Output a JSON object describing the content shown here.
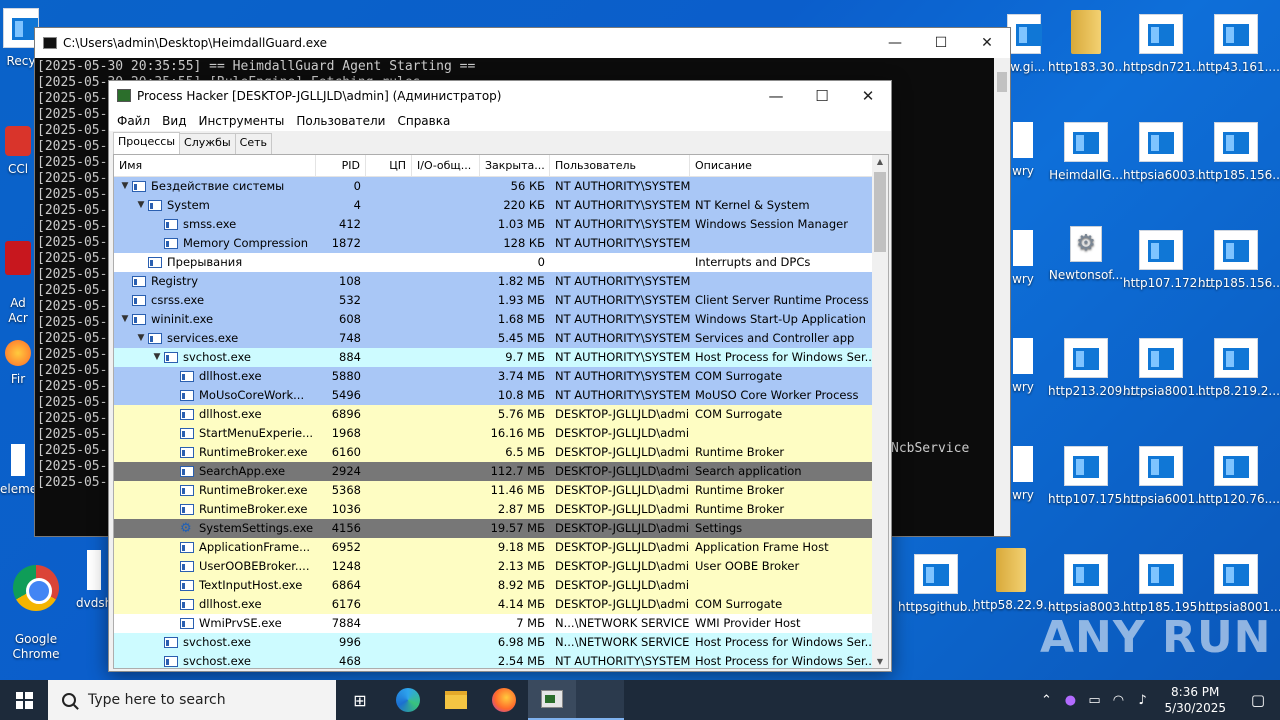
{
  "desktop": {
    "icons_left": [
      {
        "label": "Recy"
      },
      {
        "label": "CCl"
      },
      {
        "label": "Ad\nAcr"
      },
      {
        "label": "Fir"
      },
      {
        "label": "eleme"
      },
      {
        "label": "Google\nChrome"
      },
      {
        "label": "dvdsh"
      }
    ],
    "icons_right": [
      {
        "label": "aw.gi..."
      },
      {
        "label": "http183.30...."
      },
      {
        "label": "httpsdn721..."
      },
      {
        "label": "http43.161...."
      },
      {
        "label": "wry"
      },
      {
        "label": "HeimdallG..."
      },
      {
        "label": "httpsia6003..."
      },
      {
        "label": "http185.156...."
      },
      {
        "label": "wry"
      },
      {
        "label": "Newtonsof..."
      },
      {
        "label": "http107.172...."
      },
      {
        "label": "http185.156...."
      },
      {
        "label": "wry"
      },
      {
        "label": "http213.209...."
      },
      {
        "label": "httpsia8001..."
      },
      {
        "label": "http8.219.2...."
      },
      {
        "label": "wry"
      },
      {
        "label": "http107.175...."
      },
      {
        "label": "httpsia6001..."
      },
      {
        "label": "http120.76...."
      },
      {
        "label": "httpsgithub..."
      },
      {
        "label": "http58.22.9...."
      },
      {
        "label": "httpsia8003..."
      },
      {
        "label": "http185.195...."
      },
      {
        "label": "httpsia8001..."
      }
    ]
  },
  "console": {
    "title": "C:\\Users\\admin\\Desktop\\HeimdallGuard.exe",
    "lines": "[2025-05-30 20:35:55] == HeimdallGuard Agent Starting ==\n[2025-05-30 20:35:55] [RuleEngine] Fetching rules...\n[2025-05-\n[2025-05-\n[2025-05-\n[2025-05-\n[2025-05-\n[2025-05-\n[2025-05-\n[2025-05-\n[2025-05-\n[2025-05-\n[2025-05-\n[2025-05-\n[2025-05-\n[2025-05-\n[2025-05-\n[2025-05-\n[2025-05-\n[2025-05-\n[2025-05-\n[2025-05-\n[2025-05-\n[2025-05-\n[2025-05-\n[2025-05-\n[2025-05-",
    "side_text": "NcbService"
  },
  "ph": {
    "title": "Process Hacker [DESKTOP-JGLLJLD\\admin] (Администратор)",
    "menu": [
      "Файл",
      "Вид",
      "Инструменты",
      "Пользователи",
      "Справка"
    ],
    "tabs": [
      "Процессы",
      "Службы",
      "Сеть"
    ],
    "columns": {
      "name": "Имя",
      "pid": "PID",
      "cpu": "ЦП",
      "io": "I/O-общ...",
      "mem": "Закрыта...",
      "user": "Пользователь",
      "desc": "Описание"
    },
    "rows": [
      {
        "name": "Бездействие системы",
        "pid": "0",
        "mem": "56 КБ",
        "user": "NT AUTHORITY\\SYSTEM",
        "desc": "",
        "level": 0,
        "arrow": "v",
        "bg": "blue",
        "icon": "window"
      },
      {
        "name": "System",
        "pid": "4",
        "mem": "220 КБ",
        "user": "NT AUTHORITY\\SYSTEM",
        "desc": "NT Kernel & System",
        "level": 1,
        "arrow": "v",
        "bg": "blue",
        "icon": "window"
      },
      {
        "name": "smss.exe",
        "pid": "412",
        "mem": "1.03 МБ",
        "user": "NT AUTHORITY\\SYSTEM",
        "desc": "Windows Session Manager",
        "level": 2,
        "arrow": "",
        "bg": "blue",
        "icon": "window"
      },
      {
        "name": "Memory Compression",
        "pid": "1872",
        "mem": "128 КБ",
        "user": "NT AUTHORITY\\SYSTEM",
        "desc": "",
        "level": 2,
        "arrow": "",
        "bg": "blue",
        "icon": "window"
      },
      {
        "name": "Прерывания",
        "pid": "",
        "mem": "0",
        "user": "",
        "desc": "Interrupts and DPCs",
        "level": 1,
        "arrow": "",
        "bg": "white",
        "icon": "window"
      },
      {
        "name": "Registry",
        "pid": "108",
        "mem": "1.82 МБ",
        "user": "NT AUTHORITY\\SYSTEM",
        "desc": "",
        "level": 0,
        "arrow": "",
        "bg": "blue",
        "icon": "window"
      },
      {
        "name": "csrss.exe",
        "pid": "532",
        "mem": "1.93 МБ",
        "user": "NT AUTHORITY\\SYSTEM",
        "desc": "Client Server Runtime Process",
        "level": 0,
        "arrow": "",
        "bg": "blue",
        "icon": "window"
      },
      {
        "name": "wininit.exe",
        "pid": "608",
        "mem": "1.68 МБ",
        "user": "NT AUTHORITY\\SYSTEM",
        "desc": "Windows Start-Up Application",
        "level": 0,
        "arrow": "v",
        "bg": "blue",
        "icon": "window"
      },
      {
        "name": "services.exe",
        "pid": "748",
        "mem": "5.45 МБ",
        "user": "NT AUTHORITY\\SYSTEM",
        "desc": "Services and Controller app",
        "level": 1,
        "arrow": "v",
        "bg": "blue",
        "icon": "window"
      },
      {
        "name": "svchost.exe",
        "pid": "884",
        "mem": "9.7 МБ",
        "user": "NT AUTHORITY\\SYSTEM",
        "desc": "Host Process for Windows Ser...",
        "level": 2,
        "arrow": "v",
        "bg": "cyan",
        "icon": "window"
      },
      {
        "name": "dllhost.exe",
        "pid": "5880",
        "mem": "3.74 МБ",
        "user": "NT AUTHORITY\\SYSTEM",
        "desc": "COM Surrogate",
        "level": 3,
        "arrow": "",
        "bg": "blue",
        "icon": "window"
      },
      {
        "name": "MoUsoCoreWork...",
        "pid": "5496",
        "mem": "10.8 МБ",
        "user": "NT AUTHORITY\\SYSTEM",
        "desc": "MoUSO Core Worker Process",
        "level": 3,
        "arrow": "",
        "bg": "blue",
        "icon": "window"
      },
      {
        "name": "dllhost.exe",
        "pid": "6896",
        "mem": "5.76 МБ",
        "user": "DESKTOP-JGLLJLD\\admi",
        "desc": "COM Surrogate",
        "level": 3,
        "arrow": "",
        "bg": "yellow",
        "icon": "window"
      },
      {
        "name": "StartMenuExperie...",
        "pid": "1968",
        "mem": "16.16 МБ",
        "user": "DESKTOP-JGLLJLD\\admi",
        "desc": "",
        "level": 3,
        "arrow": "",
        "bg": "yellow",
        "icon": "window"
      },
      {
        "name": "RuntimeBroker.exe",
        "pid": "6160",
        "mem": "6.5 МБ",
        "user": "DESKTOP-JGLLJLD\\admi",
        "desc": "Runtime Broker",
        "level": 3,
        "arrow": "",
        "bg": "yellow",
        "icon": "window"
      },
      {
        "name": "SearchApp.exe",
        "pid": "2924",
        "mem": "112.7 МБ",
        "user": "DESKTOP-JGLLJLD\\admi",
        "desc": "Search application",
        "level": 3,
        "arrow": "",
        "bg": "dark",
        "icon": "window"
      },
      {
        "name": "RuntimeBroker.exe",
        "pid": "5368",
        "mem": "11.46 МБ",
        "user": "DESKTOP-JGLLJLD\\admi",
        "desc": "Runtime Broker",
        "level": 3,
        "arrow": "",
        "bg": "yellow",
        "icon": "window"
      },
      {
        "name": "RuntimeBroker.exe",
        "pid": "1036",
        "mem": "2.87 МБ",
        "user": "DESKTOP-JGLLJLD\\admi",
        "desc": "Runtime Broker",
        "level": 3,
        "arrow": "",
        "bg": "yellow",
        "icon": "window"
      },
      {
        "name": "SystemSettings.exe",
        "pid": "4156",
        "mem": "19.57 МБ",
        "user": "DESKTOP-JGLLJLD\\admi",
        "desc": "Settings",
        "level": 3,
        "arrow": "",
        "bg": "dark",
        "icon": "gear"
      },
      {
        "name": "ApplicationFrame...",
        "pid": "6952",
        "mem": "9.18 МБ",
        "user": "DESKTOP-JGLLJLD\\admi",
        "desc": "Application Frame Host",
        "level": 3,
        "arrow": "",
        "bg": "yellow",
        "icon": "window"
      },
      {
        "name": "UserOOBEBroker....",
        "pid": "1248",
        "mem": "2.13 МБ",
        "user": "DESKTOP-JGLLJLD\\admi",
        "desc": "User OOBE Broker",
        "level": 3,
        "arrow": "",
        "bg": "yellow",
        "icon": "window"
      },
      {
        "name": "TextInputHost.exe",
        "pid": "6864",
        "mem": "8.92 МБ",
        "user": "DESKTOP-JGLLJLD\\admi",
        "desc": "",
        "level": 3,
        "arrow": "",
        "bg": "yellow",
        "icon": "window"
      },
      {
        "name": "dllhost.exe",
        "pid": "6176",
        "mem": "4.14 МБ",
        "user": "DESKTOP-JGLLJLD\\admi",
        "desc": "COM Surrogate",
        "level": 3,
        "arrow": "",
        "bg": "yellow",
        "icon": "window"
      },
      {
        "name": "WmiPrvSE.exe",
        "pid": "7884",
        "mem": "7 МБ",
        "user": "N...\\NETWORK SERVICE",
        "desc": "WMI Provider Host",
        "level": 3,
        "arrow": "",
        "bg": "white",
        "icon": "window"
      },
      {
        "name": "svchost.exe",
        "pid": "996",
        "mem": "6.98 МБ",
        "user": "N...\\NETWORK SERVICE",
        "desc": "Host Process for Windows Ser...",
        "level": 2,
        "arrow": "",
        "bg": "cyan",
        "icon": "window"
      },
      {
        "name": "svchost.exe",
        "pid": "468",
        "mem": "2.54 МБ",
        "user": "NT AUTHORITY\\SYSTEM",
        "desc": "Host Process for Windows Ser...",
        "level": 2,
        "arrow": "",
        "bg": "cyan",
        "icon": "window"
      }
    ]
  },
  "taskbar": {
    "search_placeholder": "Type here to search",
    "time": "8:36 PM",
    "date": "5/30/2025"
  },
  "watermark": "ANY RUN"
}
